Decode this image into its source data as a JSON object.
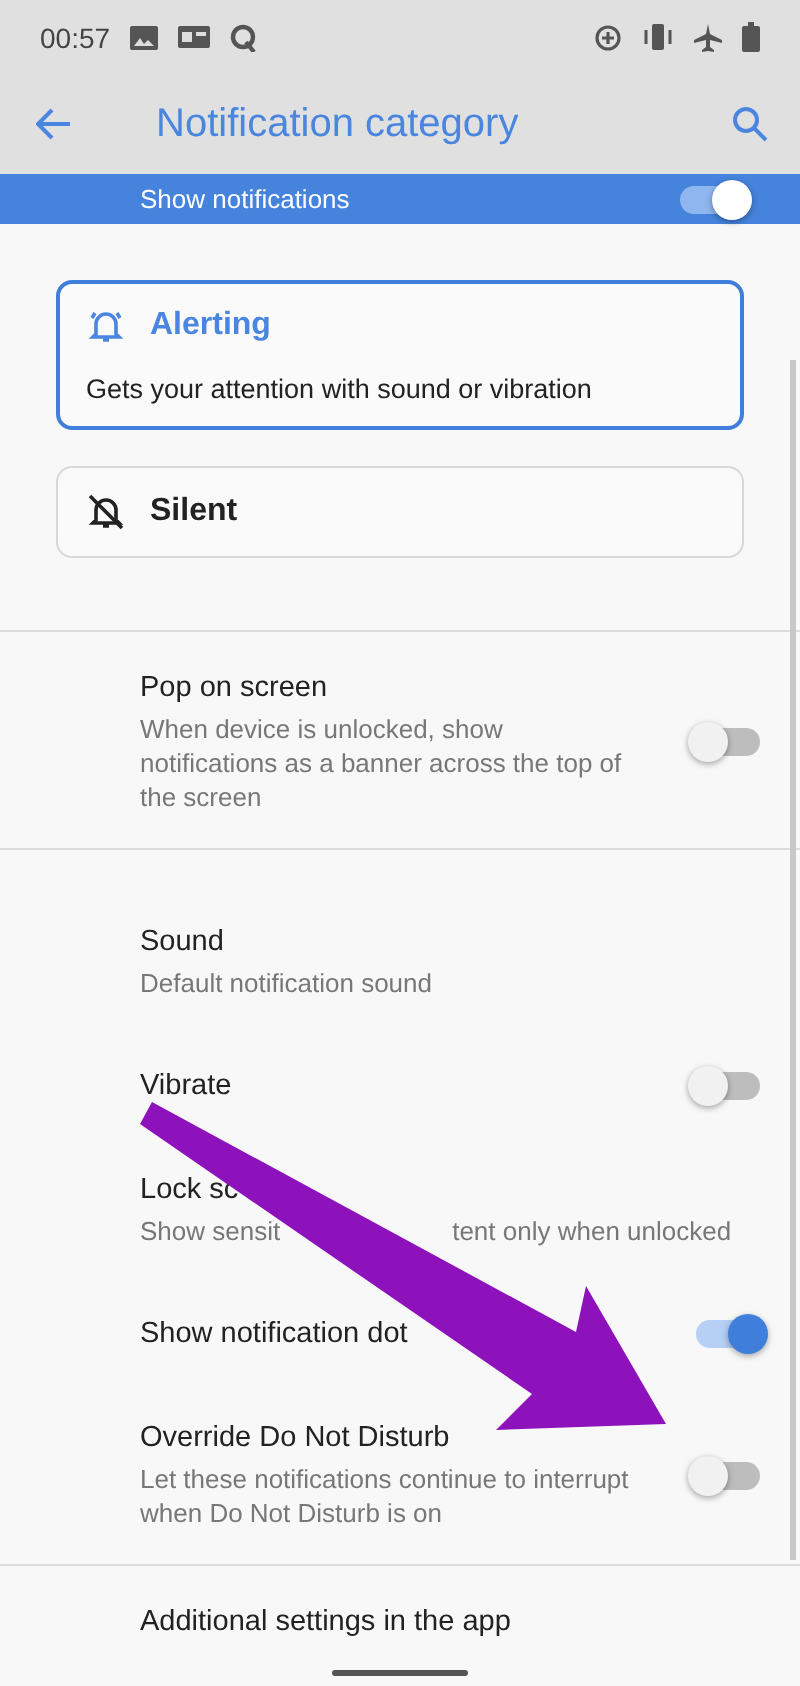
{
  "status_bar": {
    "time": "00:57"
  },
  "app_bar": {
    "title": "Notification category"
  },
  "master": {
    "label": "Show notifications",
    "on": true
  },
  "behaviors": [
    {
      "label": "Alerting",
      "description": "Gets your attention with sound or vibration",
      "selected": true,
      "kind": "alerting"
    },
    {
      "label": "Silent",
      "selected": false,
      "kind": "silent"
    }
  ],
  "sections": [
    [
      {
        "title": "Pop on screen",
        "summary": "When device is unlocked, show notifications as a banner across the top of the screen",
        "kind": "switch",
        "on": false
      }
    ],
    [
      {
        "title": "Sound",
        "summary": "Default notification sound",
        "kind": "plain"
      },
      {
        "title": "Vibrate",
        "kind": "switch",
        "on": false
      },
      {
        "title": "Lock sc",
        "summary": "Show sensit",
        "summary_end": "tent only when unlocked",
        "kind": "plain"
      },
      {
        "title": "Show notification dot",
        "kind": "switch",
        "on": true
      },
      {
        "title": "Override Do Not Disturb",
        "summary": "Let these notifications continue to interrupt when Do Not Disturb is on",
        "kind": "switch",
        "on": false
      }
    ],
    [
      {
        "title": "Additional settings in the app",
        "kind": "plain"
      }
    ]
  ]
}
